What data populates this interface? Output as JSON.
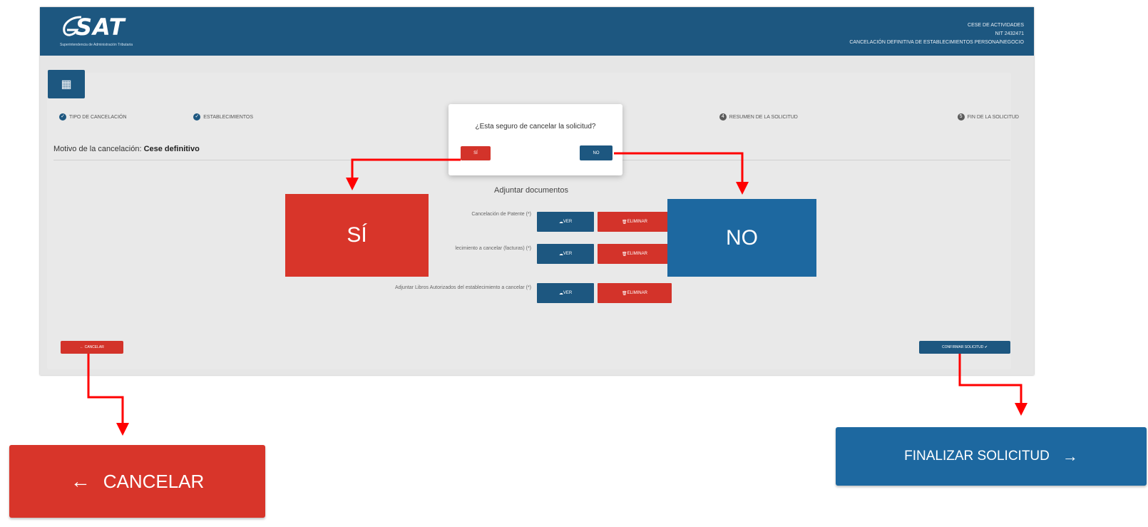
{
  "header": {
    "logo": "SAT",
    "logo_subtitle": "Superintendencia de Administración Tributaria",
    "info_line1": "CESE DE ACTIVIDADES",
    "info_line2": "NIT 2432471",
    "info_line3": "CANCELACIÓN DEFINITIVA DE ESTABLECIMIENTOS PERSONA/NEGOCIO"
  },
  "stepper": [
    {
      "label": "TIPO DE CANCELACIÓN",
      "marker": "✓"
    },
    {
      "label": "ESTABLECIMIENTOS",
      "marker": "✓"
    },
    {
      "label": "RESUMEN DE LA SOLICITUD",
      "marker": "4"
    },
    {
      "label": "FIN DE LA SOLICITUD",
      "marker": "5"
    }
  ],
  "motivo": {
    "label": "Motivo de la cancelación:",
    "value": "Cese definitivo"
  },
  "adjuntar": {
    "title": "Adjuntar documentos",
    "rows": [
      {
        "label": "Cancelación de Patente (*)",
        "ver": "VER",
        "eliminar": "ELIMINAR"
      },
      {
        "label": "lecimiento a cancelar (facturas) (*)",
        "ver": "VER",
        "eliminar": "ELIMINAR"
      },
      {
        "label": "Adjuntar Libros Autorizados del establecimiento a cancelar (*)",
        "ver": "VER",
        "eliminar": "ELIMINAR"
      }
    ]
  },
  "footer": {
    "cancel": "← CANCELAR",
    "confirm": "CONFIRMAR SOLICITUD"
  },
  "modal": {
    "question": "¿Esta seguro de cancelar la solicitud?",
    "yes": "SÍ",
    "no": "NO"
  },
  "callouts": {
    "si": "SÍ",
    "no": "NO",
    "cancel_arrow": "←",
    "cancel": "CANCELAR",
    "final": "FINALIZAR SOLICITUD",
    "final_arrow": "→"
  },
  "colors": {
    "primary": "#1d5780",
    "danger": "#d3332a",
    "annotation": "#ff0000"
  }
}
